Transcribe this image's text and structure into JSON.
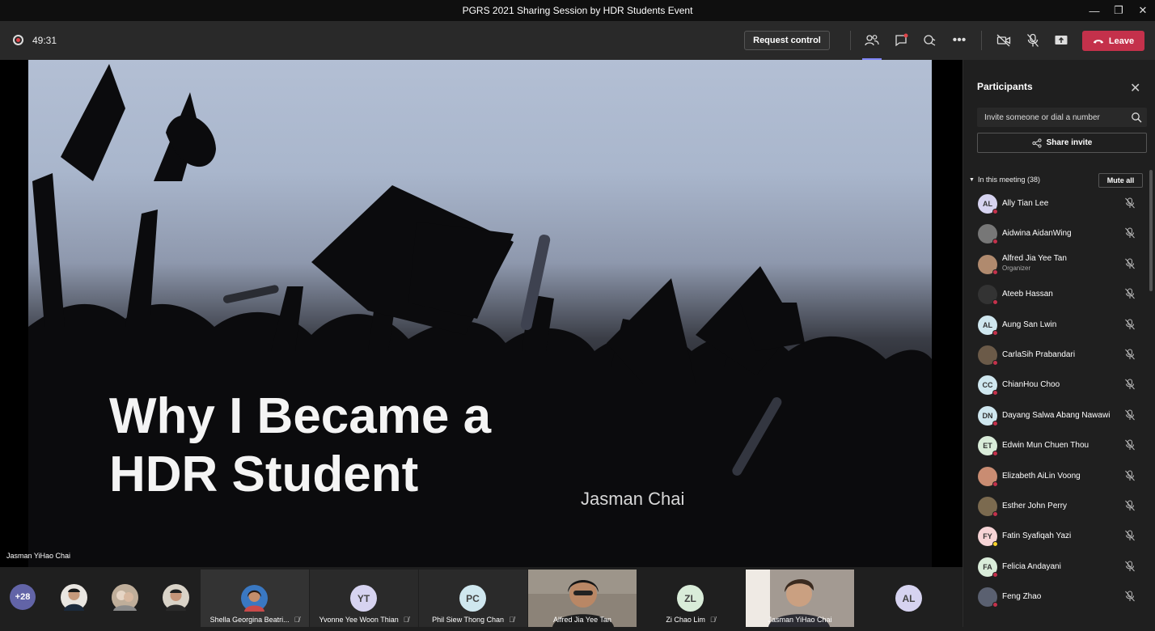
{
  "window": {
    "title": "PGRS 2021 Sharing Session by HDR Students Event"
  },
  "toolbar": {
    "timer": "49:31",
    "request_control": "Request control",
    "leave": "Leave"
  },
  "slide": {
    "title_line1": "Why I Became a",
    "title_line2": "HDR Student",
    "author": "Jasman Chai"
  },
  "stage": {
    "speaker_name": "Jasman YiHao Chai"
  },
  "gallery": {
    "overflow_count": "+28",
    "tiles": [
      {
        "name": "Shella Georgina Beatri...",
        "initials": ""
      },
      {
        "name": "Yvonne Yee Woon Thian",
        "initials": "YT"
      },
      {
        "name": "Phil Siew Thong Chan",
        "initials": "PC"
      },
      {
        "name": "Alfred Jia Yee Tan",
        "initials": ""
      },
      {
        "name": "Zi Chao Lim",
        "initials": "ZL"
      },
      {
        "name": "Jasman YiHao Chai",
        "initials": ""
      },
      {
        "name": "",
        "initials": "AL"
      }
    ]
  },
  "participants": {
    "title": "Participants",
    "invite_placeholder": "Invite someone or dial a number",
    "share_invite": "Share invite",
    "section_label": "In this meeting (38)",
    "mute_all": "Mute all",
    "list": [
      {
        "name": "Ally Tian Lee",
        "initials": "AL",
        "color": "#d6d3f0",
        "role": ""
      },
      {
        "name": "Aidwina AidanWing",
        "initials": "",
        "color": "#777777",
        "role": ""
      },
      {
        "name": "Alfred Jia Yee Tan",
        "initials": "",
        "color": "#b08a6e",
        "role": "Organizer"
      },
      {
        "name": "Ateeb Hassan",
        "initials": "",
        "color": "#333333",
        "role": ""
      },
      {
        "name": "Aung San Lwin",
        "initials": "AL",
        "color": "#cfe7ef",
        "role": ""
      },
      {
        "name": "CarlaSih Prabandari",
        "initials": "",
        "color": "#6b5a48",
        "role": ""
      },
      {
        "name": "ChianHou Choo",
        "initials": "CC",
        "color": "#cfe7ef",
        "role": ""
      },
      {
        "name": "Dayang Salwa Abang Nawawi",
        "initials": "DN",
        "color": "#cfe7ef",
        "role": ""
      },
      {
        "name": "Edwin Mun Chuen Thou",
        "initials": "ET",
        "color": "#d9ecd9",
        "role": ""
      },
      {
        "name": "Elizabeth AiLin Voong",
        "initials": "",
        "color": "#c98c72",
        "role": ""
      },
      {
        "name": "Esther John Perry",
        "initials": "",
        "color": "#7b6a4f",
        "role": ""
      },
      {
        "name": "Fatin Syafiqah Yazi",
        "initials": "FY",
        "color": "#f6d4d6",
        "role": ""
      },
      {
        "name": "Felicia Andayani",
        "initials": "FA",
        "color": "#d9ecd9",
        "role": ""
      },
      {
        "name": "Feng Zhao",
        "initials": "",
        "color": "#5a6070",
        "role": ""
      }
    ]
  }
}
